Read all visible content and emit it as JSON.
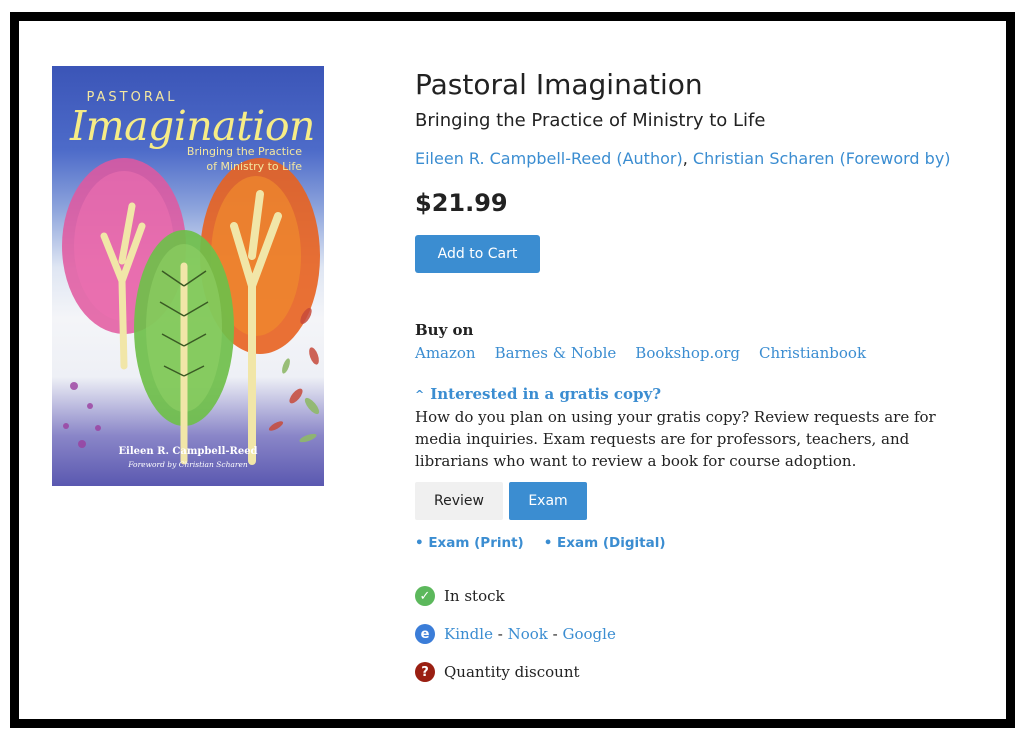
{
  "book": {
    "title": "Pastoral Imagination",
    "subtitle": "Bringing the Practice of Ministry to Life",
    "authors": [
      {
        "name": "Eileen R. Campbell-Reed (Author)"
      },
      {
        "name": "Christian Scharen (Foreword by)"
      }
    ],
    "author_separator": ",",
    "price": "$21.99"
  },
  "cover": {
    "pastoral": "PASTORAL",
    "imagination": "Imagination",
    "subtitle_line1": "Bringing the Practice",
    "subtitle_line2": "of Ministry to Life",
    "author": "Eileen R. Campbell-Reed",
    "foreword": "Foreword by Christian Scharen"
  },
  "cart": {
    "add_label": "Add to Cart"
  },
  "buy_on": {
    "label": "Buy on",
    "retailers": [
      "Amazon",
      "Barnes & Noble",
      "Bookshop.org",
      "Christianbook"
    ]
  },
  "gratis": {
    "toggle_label": "Interested in a gratis copy?",
    "description": "How do you plan on using your gratis copy? Review requests are for media inquiries. Exam requests are for professors, teachers, and librarians who want to review a book for course adoption.",
    "review_label": "Review",
    "exam_label": "Exam",
    "exam_options": [
      "• Exam (Print)",
      "• Exam (Digital)"
    ]
  },
  "status": {
    "in_stock": "In stock",
    "ebook_icon_letter": "e",
    "ebooks": [
      "Kindle",
      "Nook",
      "Google"
    ],
    "ebook_separator": "-",
    "discount_icon": "?",
    "quantity_discount": "Quantity discount"
  },
  "colors": {
    "link": "#3b8dd1",
    "in_stock_green": "#5cb85c",
    "ebook_blue": "#3b7dd8",
    "discount_red": "#9a1f12"
  },
  "icons": {
    "in_stock": "checkmark-circle-icon",
    "ebook": "ebook-e-icon",
    "discount": "question-circle-icon",
    "toggle": "chevron-up-icon"
  }
}
